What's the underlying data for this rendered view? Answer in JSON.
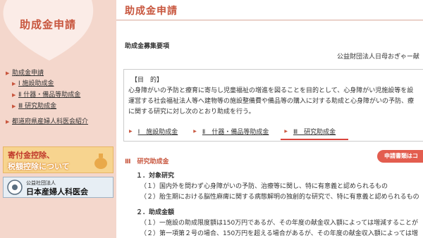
{
  "sidebar": {
    "title": "助成金申請",
    "nav": [
      {
        "label": "助成金申請",
        "level": 0
      },
      {
        "label": "Ⅰ 施設助成金",
        "level": 1
      },
      {
        "label": "Ⅱ 什器・備品等助成金",
        "level": 1
      },
      {
        "label": "Ⅲ 研究助成金",
        "level": 1
      },
      {
        "label": "都道府県産婦人科医会紹介",
        "level": 0
      }
    ],
    "banner_tax": {
      "line1": "寄付金控除、",
      "line2": "税額控除について"
    },
    "banner_org": {
      "small": "公益社団法人",
      "big": "日本産婦人科医会"
    }
  },
  "main": {
    "page_title": "助成金申請",
    "section_heading": "助成金募集要項",
    "org_name": "公益財団法人日母おぎゃー献",
    "purpose": {
      "label": "【目　的】",
      "lines": [
        "心身障がいの予防と療育に寄与し児童福祉の増進を図ることを目的として、心身障がい児施設等を設",
        "運営する社会福祉法人等へ建物等の施設整備費や備品等の購入に対する助成と心身障がいの予防、療",
        "に関する研究に対し次のとおり助成を行う。"
      ]
    },
    "tabs": [
      "Ⅰ　施設助成金",
      "Ⅱ　什器・備品等助成金",
      "Ⅲ　研究助成金"
    ],
    "active_tab": 2,
    "current_section": "Ⅲ　研究助成金",
    "apply_button": "申請書類はコ",
    "content": {
      "h1": "１．対象研究",
      "h1_items": [
        "（１）国内外を問わず心身障がいの予防、治療等に関し、特に有意義と認められるもの",
        "（２）胎生期における脳性麻痺に関する病態解明の独創的な研究で、特に有意義と認められるもの"
      ],
      "h2": "２．助成金額",
      "h2_items": [
        "（１）一施設の助成限度額は150万円であるが、その年度の献金収入額によっては増減することが",
        "（２）第一項第２号の場合、150万円を超える場合があるが、その年度の献金収入額によっては増"
      ]
    }
  },
  "colors": {
    "accent": "#c8563e",
    "sidebar_bg": "#f4d7cc",
    "button": "#e35d4f"
  }
}
